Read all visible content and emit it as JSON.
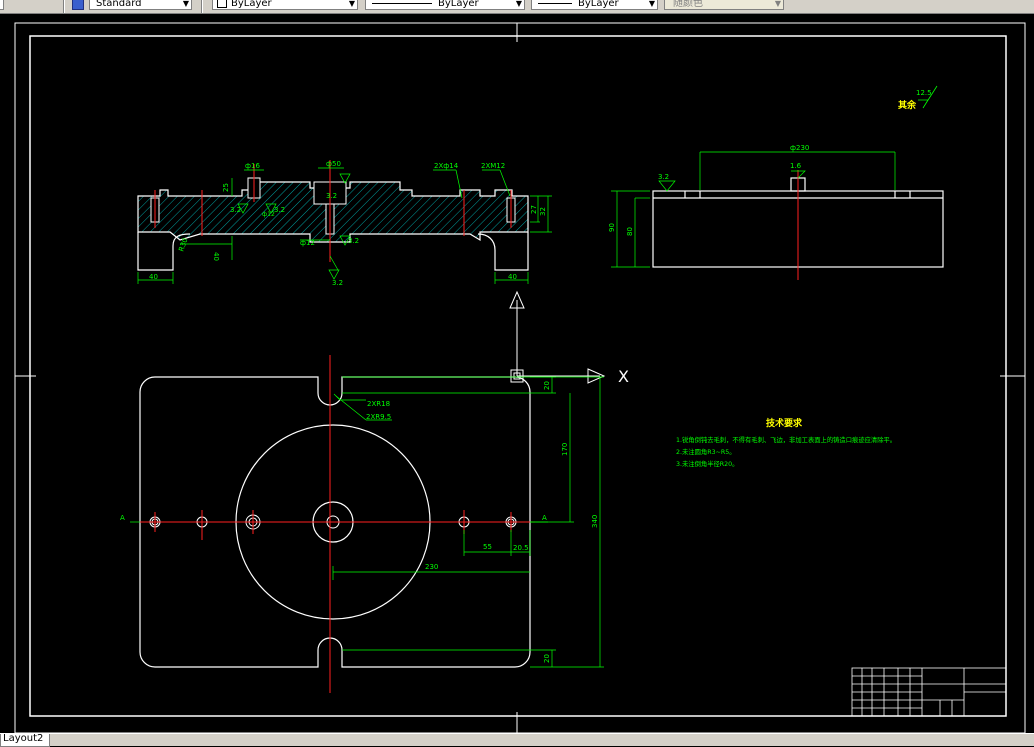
{
  "toolbar": {
    "text_style": "Standard",
    "layer_color": "ByLayer",
    "linetype": "ByLayer",
    "lineweight": "ByLayer",
    "plot_style": "随颜色"
  },
  "tabs": {
    "layout_tab": "Layout2"
  },
  "drawing": {
    "roughness_other_label": "其余",
    "roughness_other_value": "12.5",
    "tech_title": "技术要求",
    "tech_line1": "1.锐角倒钝去毛刺，不得有毛刺、飞边，非加工表面上的铸造口痕迹应清除平。",
    "tech_line2": "2.未注圆角R3~R5。",
    "tech_line3": "3.未注倒角半径R20。",
    "dims": {
      "d16": "ф16",
      "d50": "ф50",
      "hole2x14": "2Xф14",
      "hole2xm12": "2XM12",
      "r25": "25",
      "v32a": "3.2",
      "v32b": "3.2",
      "v32c": "3.2",
      "v32d": "3.2",
      "v32e": "3.2",
      "w40a": "40",
      "w40b": "40",
      "w40c": "40",
      "h27": "27",
      "h32": "32",
      "r30": "R30",
      "d230": "ф230",
      "d18top": "1.6",
      "h90": "90",
      "h80": "80",
      "v32right": "3.2",
      "d2xr18": "2XR18",
      "d2xr95": "2XR9.5",
      "d20a": "20",
      "d170": "170",
      "d340": "340",
      "d55": "55",
      "d205": "20.5",
      "d230b": "230",
      "d20b": "20",
      "section_a_left": "A",
      "section_a_right": "A",
      "axis_x": "X",
      "d12": "ф12",
      "d12b": "ф12"
    }
  }
}
